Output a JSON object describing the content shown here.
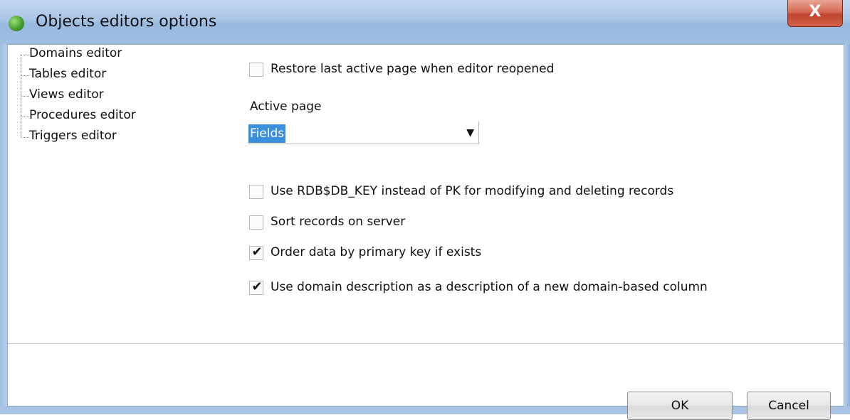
{
  "window": {
    "title": "Objects editors options",
    "close_label": "X"
  },
  "tree": {
    "items": [
      {
        "label": "Domains editor"
      },
      {
        "label": "Tables editor"
      },
      {
        "label": "Views editor"
      },
      {
        "label": "Procedures editor"
      },
      {
        "label": "Triggers editor"
      }
    ]
  },
  "options": {
    "restore_last_page": {
      "label": "Restore last active page when editor reopened",
      "checked": false
    },
    "active_page_label": "Active page",
    "active_page_value": "Fields",
    "use_rdb_key": {
      "label": "Use RDB$DB_KEY instead of PK for modifying and deleting records",
      "checked": false
    },
    "sort_on_server": {
      "label": "Sort records on server",
      "checked": false
    },
    "order_by_pk": {
      "label": "Order data by primary key if exists",
      "checked": true
    },
    "use_domain_description": {
      "label": "Use domain description as a description of a new domain-based column",
      "checked": true
    }
  },
  "buttons": {
    "ok_label": "OK",
    "cancel_label": "Cancel"
  },
  "icons": {
    "app": "app-icon",
    "checkmark": "✔",
    "dropdown": "▼"
  },
  "colors": {
    "titlebar": "#a9c5e6",
    "close_button": "#c2452c",
    "selection": "#3b8fdc"
  }
}
